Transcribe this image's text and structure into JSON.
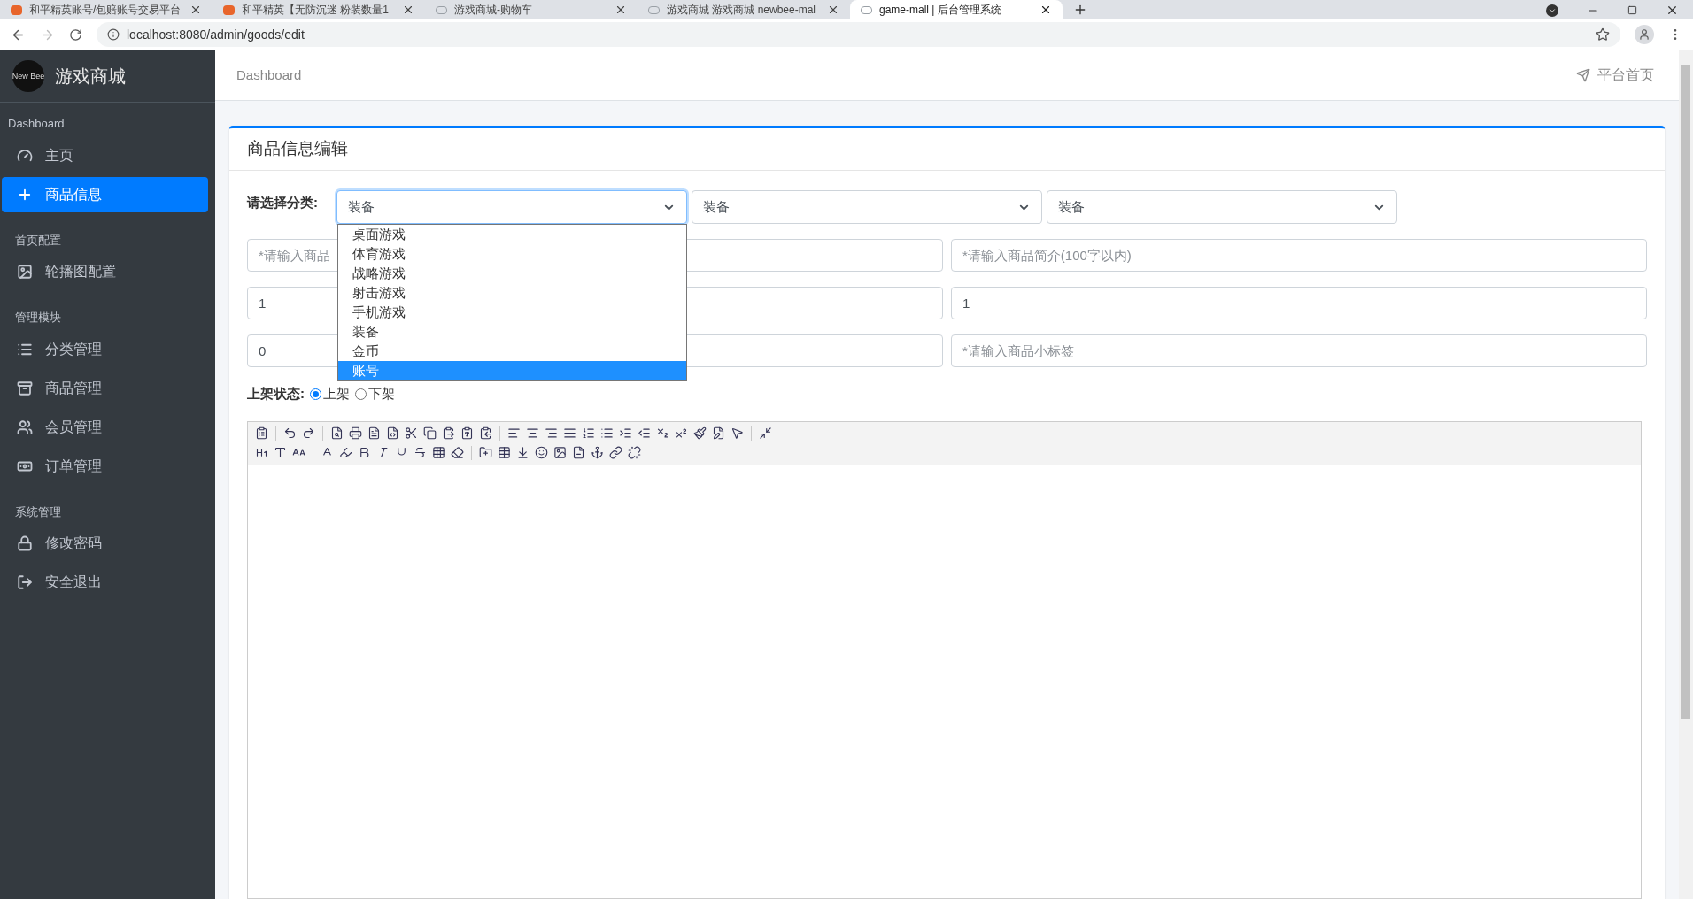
{
  "browser": {
    "tabs": [
      {
        "title": "和平精英账号/包赔账号交易平台",
        "selected": false,
        "kind": "store"
      },
      {
        "title": "和平精英【无防沉迷 粉装数量1",
        "selected": false,
        "kind": "store"
      },
      {
        "title": "游戏商城-购物车",
        "selected": false,
        "kind": "bee"
      },
      {
        "title": "游戏商城 游戏商城 newbee-mal",
        "selected": false,
        "kind": "bee"
      },
      {
        "title": "game-mall | 后台管理系统",
        "selected": true,
        "kind": "bee"
      }
    ],
    "url": "localhost:8080/admin/goods/edit"
  },
  "sidebar": {
    "logo_text": "New Bee",
    "brand": "游戏商城",
    "sections": [
      {
        "heading": "Dashboard",
        "items": [
          {
            "label": "主页",
            "selected": false
          },
          {
            "label": "商品信息",
            "selected": true
          }
        ]
      },
      {
        "heading": "首页配置",
        "items": [
          {
            "label": "轮播图配置",
            "selected": false
          }
        ]
      },
      {
        "heading": "管理模块",
        "items": [
          {
            "label": "分类管理",
            "selected": false
          },
          {
            "label": "商品管理",
            "selected": false
          },
          {
            "label": "会员管理",
            "selected": false
          },
          {
            "label": "订单管理",
            "selected": false
          }
        ]
      },
      {
        "heading": "系统管理",
        "items": [
          {
            "label": "修改密码",
            "selected": false
          },
          {
            "label": "安全退出",
            "selected": false
          }
        ]
      }
    ]
  },
  "navbar": {
    "breadcrumb": "Dashboard",
    "home_link": "平台首页"
  },
  "card": {
    "title": "商品信息编辑",
    "category_label": "请选择分类:",
    "category_selects": [
      {
        "value": "装备",
        "focused": true
      },
      {
        "value": "装备",
        "focused": false
      },
      {
        "value": "装备",
        "focused": false
      }
    ],
    "dropdown_options": [
      {
        "label": "桌面游戏",
        "selected": false
      },
      {
        "label": "体育游戏",
        "selected": false
      },
      {
        "label": "战略游戏",
        "selected": false
      },
      {
        "label": "射击游戏",
        "selected": false
      },
      {
        "label": "手机游戏",
        "selected": false
      },
      {
        "label": "装备",
        "selected": false
      },
      {
        "label": "金币",
        "selected": false
      },
      {
        "label": "账号",
        "selected": true
      }
    ],
    "fields": [
      {
        "placeholder": "*请输入商品"
      },
      {
        "placeholder": "*请输入商品简介(100字以内)"
      },
      {
        "value": "1"
      },
      {
        "value": "1"
      },
      {
        "value": "0"
      },
      {
        "placeholder": "*请输入商品小标签"
      }
    ],
    "status_label": "上架状态:",
    "status_options": [
      {
        "label": "上架",
        "selected": true
      },
      {
        "label": "下架",
        "selected": false
      }
    ]
  }
}
